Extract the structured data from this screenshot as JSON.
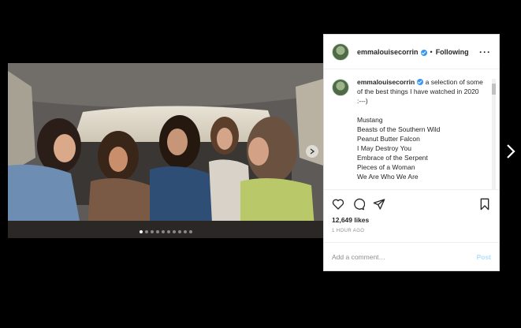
{
  "post": {
    "username": "emmalouisecorrin",
    "follow_separator": "•",
    "follow_status": "Following",
    "more_icon": "more-options-icon",
    "caption_intro": "a selection of some of the best things I have watched in 2020 :---)",
    "films": [
      "Mustang",
      "Beasts of the Southern Wild",
      "Peanut Butter Falcon",
      "I May Destroy You",
      "Embrace of the Serpent",
      "Pieces of a Woman",
      "We Are Who We Are"
    ],
    "likes": "12,649 likes",
    "time": "1 HOUR AGO",
    "comment_placeholder": "Add a comment…",
    "post_label": "Post",
    "carousel_slides": 10,
    "carousel_active": 1
  },
  "colors": {
    "background": "#000000",
    "panel": "#ffffff",
    "verified": "#3897f0",
    "post_disabled": "#b2dffc"
  }
}
